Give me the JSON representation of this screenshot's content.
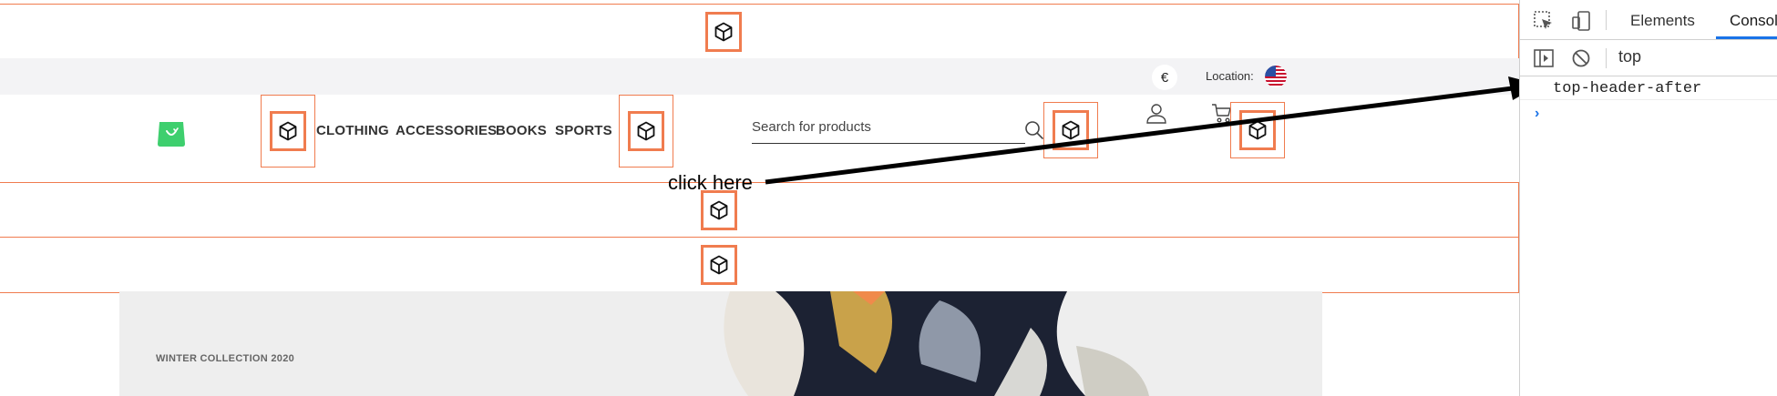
{
  "site": {
    "topbar": {
      "currency_symbol": "€",
      "location_label": "Location:",
      "flag": "us-flag-icon"
    },
    "nav": {
      "items": [
        {
          "label": "CLOTHING"
        },
        {
          "label": "ACCESSORIES"
        },
        {
          "label": "BOOKS"
        },
        {
          "label": "SPORTS"
        }
      ],
      "search": {
        "placeholder": "Search for products"
      }
    },
    "hero": {
      "title": "WINTER COLLECTION 2020"
    },
    "slot_icon": "cube-icon",
    "colors": {
      "slot_border": "#f07c4f",
      "logo": "#3ecf6e",
      "topbar_bg": "#f3f3f5"
    }
  },
  "annotation": {
    "text": "click here"
  },
  "devtools": {
    "tabs": [
      {
        "label": "Elements"
      },
      {
        "label": "Console"
      }
    ],
    "context": "top",
    "log_lines": [
      "top-header-after"
    ],
    "prompt": "›"
  }
}
